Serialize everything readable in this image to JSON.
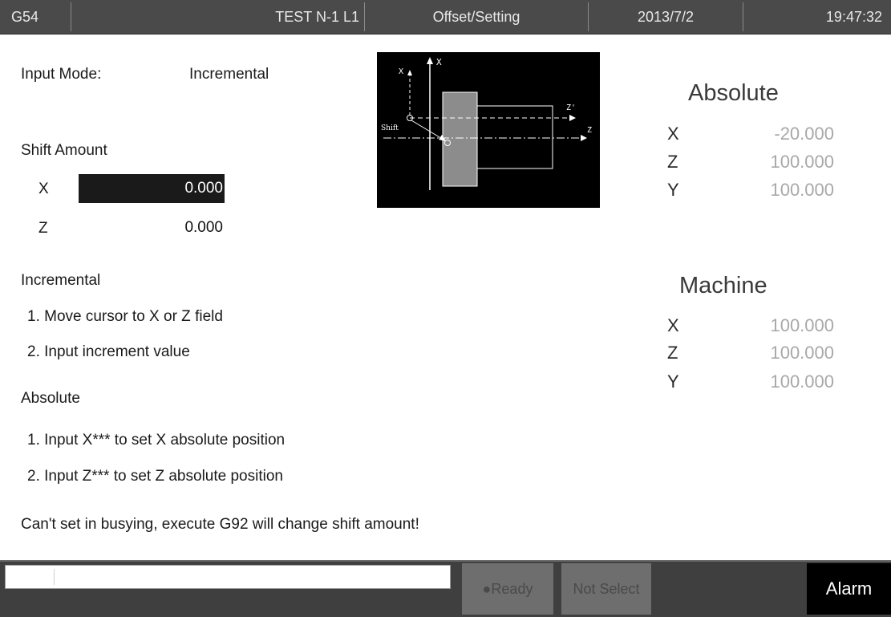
{
  "header": {
    "coordinate_system": "G54",
    "program": "TEST N-1 L1",
    "screen_title": "Offset/Setting",
    "date": "2013/7/2",
    "time": "19:47:32"
  },
  "input_mode": {
    "label": "Input Mode:",
    "value": "Incremental"
  },
  "shift_amount": {
    "title": "Shift Amount",
    "rows": [
      {
        "axis": "X",
        "value": "0.000",
        "selected": true
      },
      {
        "axis": "Z",
        "value": "0.000",
        "selected": false
      }
    ]
  },
  "diagram": {
    "labels": {
      "x_top": "X",
      "x_left": "X",
      "z_prime": "Z'",
      "z": "Z",
      "shift": "Shift"
    }
  },
  "instructions": {
    "incremental_title": "Incremental",
    "incremental_steps": [
      "1. Move cursor to X or Z field",
      "2. Input increment value"
    ],
    "absolute_title": "Absolute",
    "absolute_steps": [
      "1. Input X*** to set X absolute position",
      "2. Input Z*** to set Z absolute position"
    ],
    "warning": "Can't set in busying, execute G92 will change shift amount!"
  },
  "absolute_position": {
    "title": "Absolute",
    "rows": [
      {
        "axis": "X",
        "value": "-20.000"
      },
      {
        "axis": "Z",
        "value": "100.000"
      },
      {
        "axis": "Y",
        "value": "100.000"
      }
    ]
  },
  "machine_position": {
    "title": "Machine",
    "rows": [
      {
        "axis": "X",
        "value": "100.000"
      },
      {
        "axis": "Z",
        "value": "100.000"
      },
      {
        "axis": "Y",
        "value": "100.000"
      }
    ]
  },
  "status_bar": {
    "input_value": "",
    "ready": "●Ready",
    "not_select": "Not Select",
    "alarm": "Alarm"
  }
}
